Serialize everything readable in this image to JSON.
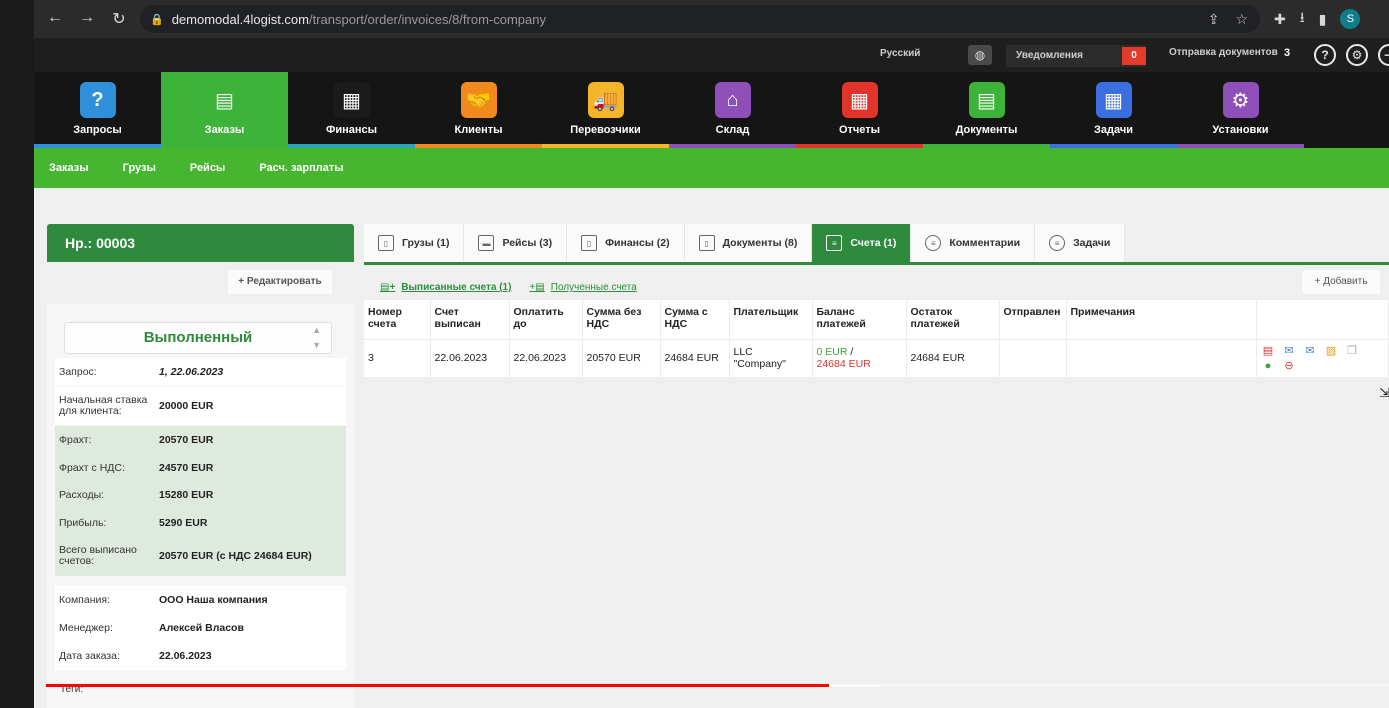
{
  "browser": {
    "url_domain": "demomodal.4logist.com",
    "url_path": "/transport/order/invoices/8/from-company",
    "profile_initial": "S"
  },
  "topbar": {
    "language": "Русский",
    "notifications_label": "Уведомления",
    "notifications_count": "0",
    "send_docs_label": "Отправка документов",
    "send_docs_count": "3",
    "help_icon": "?"
  },
  "main_nav": [
    {
      "label": "Запросы",
      "icon": "?",
      "color": "#2f8fd8",
      "bar": "#2f8fd8"
    },
    {
      "label": "Заказы",
      "icon": "▤",
      "color": "#3db33a",
      "bar": "#3db33a"
    },
    {
      "label": "Финансы",
      "icon": "▦",
      "color": "#1b1b1b",
      "bar": "#2aa6b8"
    },
    {
      "label": "Клиенты",
      "icon": "🤝",
      "color": "#f08a1c",
      "bar": "#f08a1c"
    },
    {
      "label": "Перевозчики",
      "icon": "🚚",
      "color": "#f3b52a",
      "bar": "#f3b52a"
    },
    {
      "label": "Склад",
      "icon": "⌂",
      "color": "#8e4fb8",
      "bar": "#8e4fb8"
    },
    {
      "label": "Отчеты",
      "icon": "▦",
      "color": "#e0342b",
      "bar": "#e0342b"
    },
    {
      "label": "Документы",
      "icon": "▤",
      "color": "#3db33a",
      "bar": "#3db33a"
    },
    {
      "label": "Задачи",
      "icon": "▦",
      "color": "#3b6fe0",
      "bar": "#3b6fe0"
    },
    {
      "label": "Установки",
      "icon": "⚙",
      "color": "#8e4fb8",
      "bar": "#8e4fb8"
    }
  ],
  "sub_nav": [
    "Заказы",
    "Грузы",
    "Рейсы",
    "Расч. зарплаты"
  ],
  "order": {
    "title": "Нр.: 00003",
    "edit_label": "+ Редактировать",
    "status": "Выполненный",
    "rows": [
      {
        "k": "Запрос:",
        "v": "1, 22.06.2023"
      },
      {
        "k": "Начальная ставка для клиента:",
        "v": "20000 EUR"
      },
      {
        "k": "Фрахт:",
        "v": "20570 EUR"
      },
      {
        "k": "Фрахт с НДС:",
        "v": "24570 EUR"
      },
      {
        "k": "Расходы:",
        "v": "15280 EUR"
      },
      {
        "k": "Прибыль:",
        "v": "5290 EUR"
      },
      {
        "k": "Всего выписано счетов:",
        "v": "20570 EUR (с НДС 24684 EUR)"
      },
      {
        "k": "Компания:",
        "v": "ООО Наша компания"
      },
      {
        "k": "Менеджер:",
        "v": "Алексей Власов"
      },
      {
        "k": "Дата заказа:",
        "v": "22.06.2023"
      }
    ],
    "tags_label": "Теги:"
  },
  "tabs": [
    {
      "label": "Грузы (1)"
    },
    {
      "label": "Рейсы (3)"
    },
    {
      "label": "Финансы (2)"
    },
    {
      "label": "Документы (8)"
    },
    {
      "label": "Счета (1)"
    },
    {
      "label": "Комментарии"
    },
    {
      "label": "Задачи"
    }
  ],
  "subtabs": {
    "issued": "Выписанные счета (1)",
    "received": "Полученные счета",
    "add": "+ Добавить"
  },
  "invoice_table": {
    "headers": [
      "Номер счета",
      "Счет выписан",
      "Оплатить до",
      "Сумма без НДС",
      "Сумма с НДС",
      "Плательщик",
      "Баланс платежей",
      "Остаток платежей",
      "Отправлен",
      "Примечания",
      ""
    ],
    "row": {
      "number": "3",
      "issued": "22.06.2023",
      "due": "22.06.2023",
      "sum_no_vat": "20570 EUR",
      "sum_vat": "24684 EUR",
      "payer": "LLC \"Company\"",
      "balance_paid": "0 EUR",
      "balance_sep": " /",
      "balance_total": "24684 EUR",
      "remaining": "24684 EUR",
      "sent": "",
      "notes": ""
    }
  },
  "video": {
    "progress": 0.583,
    "buffered": 0.622
  }
}
